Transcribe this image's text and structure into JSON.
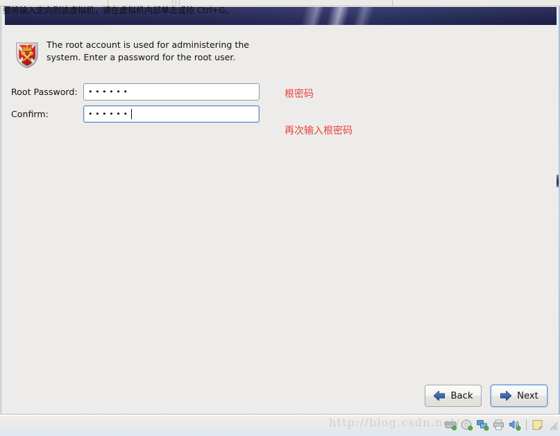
{
  "window": {
    "kind": "vmware-guest-window"
  },
  "installer": {
    "banner_title": "",
    "intro": {
      "icon": "shield-key-icon",
      "text": "The root account is used for administering the system.  Enter a password for the root user."
    },
    "fields": [
      {
        "key": "root_password",
        "label": "Root Password:",
        "value": "••••••",
        "masked_length": 6,
        "focused": false
      },
      {
        "key": "confirm",
        "label": "Confirm:",
        "value": "••••••",
        "masked_length": 6,
        "focused": true
      }
    ],
    "annotations": [
      {
        "key": "root_password_note",
        "text": "根密码",
        "color": "#e8433c"
      },
      {
        "key": "confirm_note",
        "text": "再次输入根密码",
        "color": "#e8433c"
      }
    ],
    "buttons": {
      "back": {
        "label": "Back",
        "icon": "arrow-left-icon",
        "focused": false
      },
      "next": {
        "label": "Next",
        "icon": "arrow-right-icon",
        "focused": true
      }
    }
  },
  "status_bar": {
    "message": "要将输入定向到该虚拟机，请在虚拟机内部单击或按 Ctrl+G。",
    "watermark": "http://blog.csdn.net/",
    "tray_icons": [
      "hard-disk-icon",
      "cd-dvd-icon",
      "network-adapter-icon",
      "printer-icon",
      "sound-card-icon",
      "note-icon"
    ]
  },
  "colors": {
    "banner_navy": "#262a5c",
    "annotation_red": "#e8433c",
    "guest_background": "#edecea",
    "focus_blue": "#5a8ac6",
    "arrow_blue": "#2f63ab"
  }
}
